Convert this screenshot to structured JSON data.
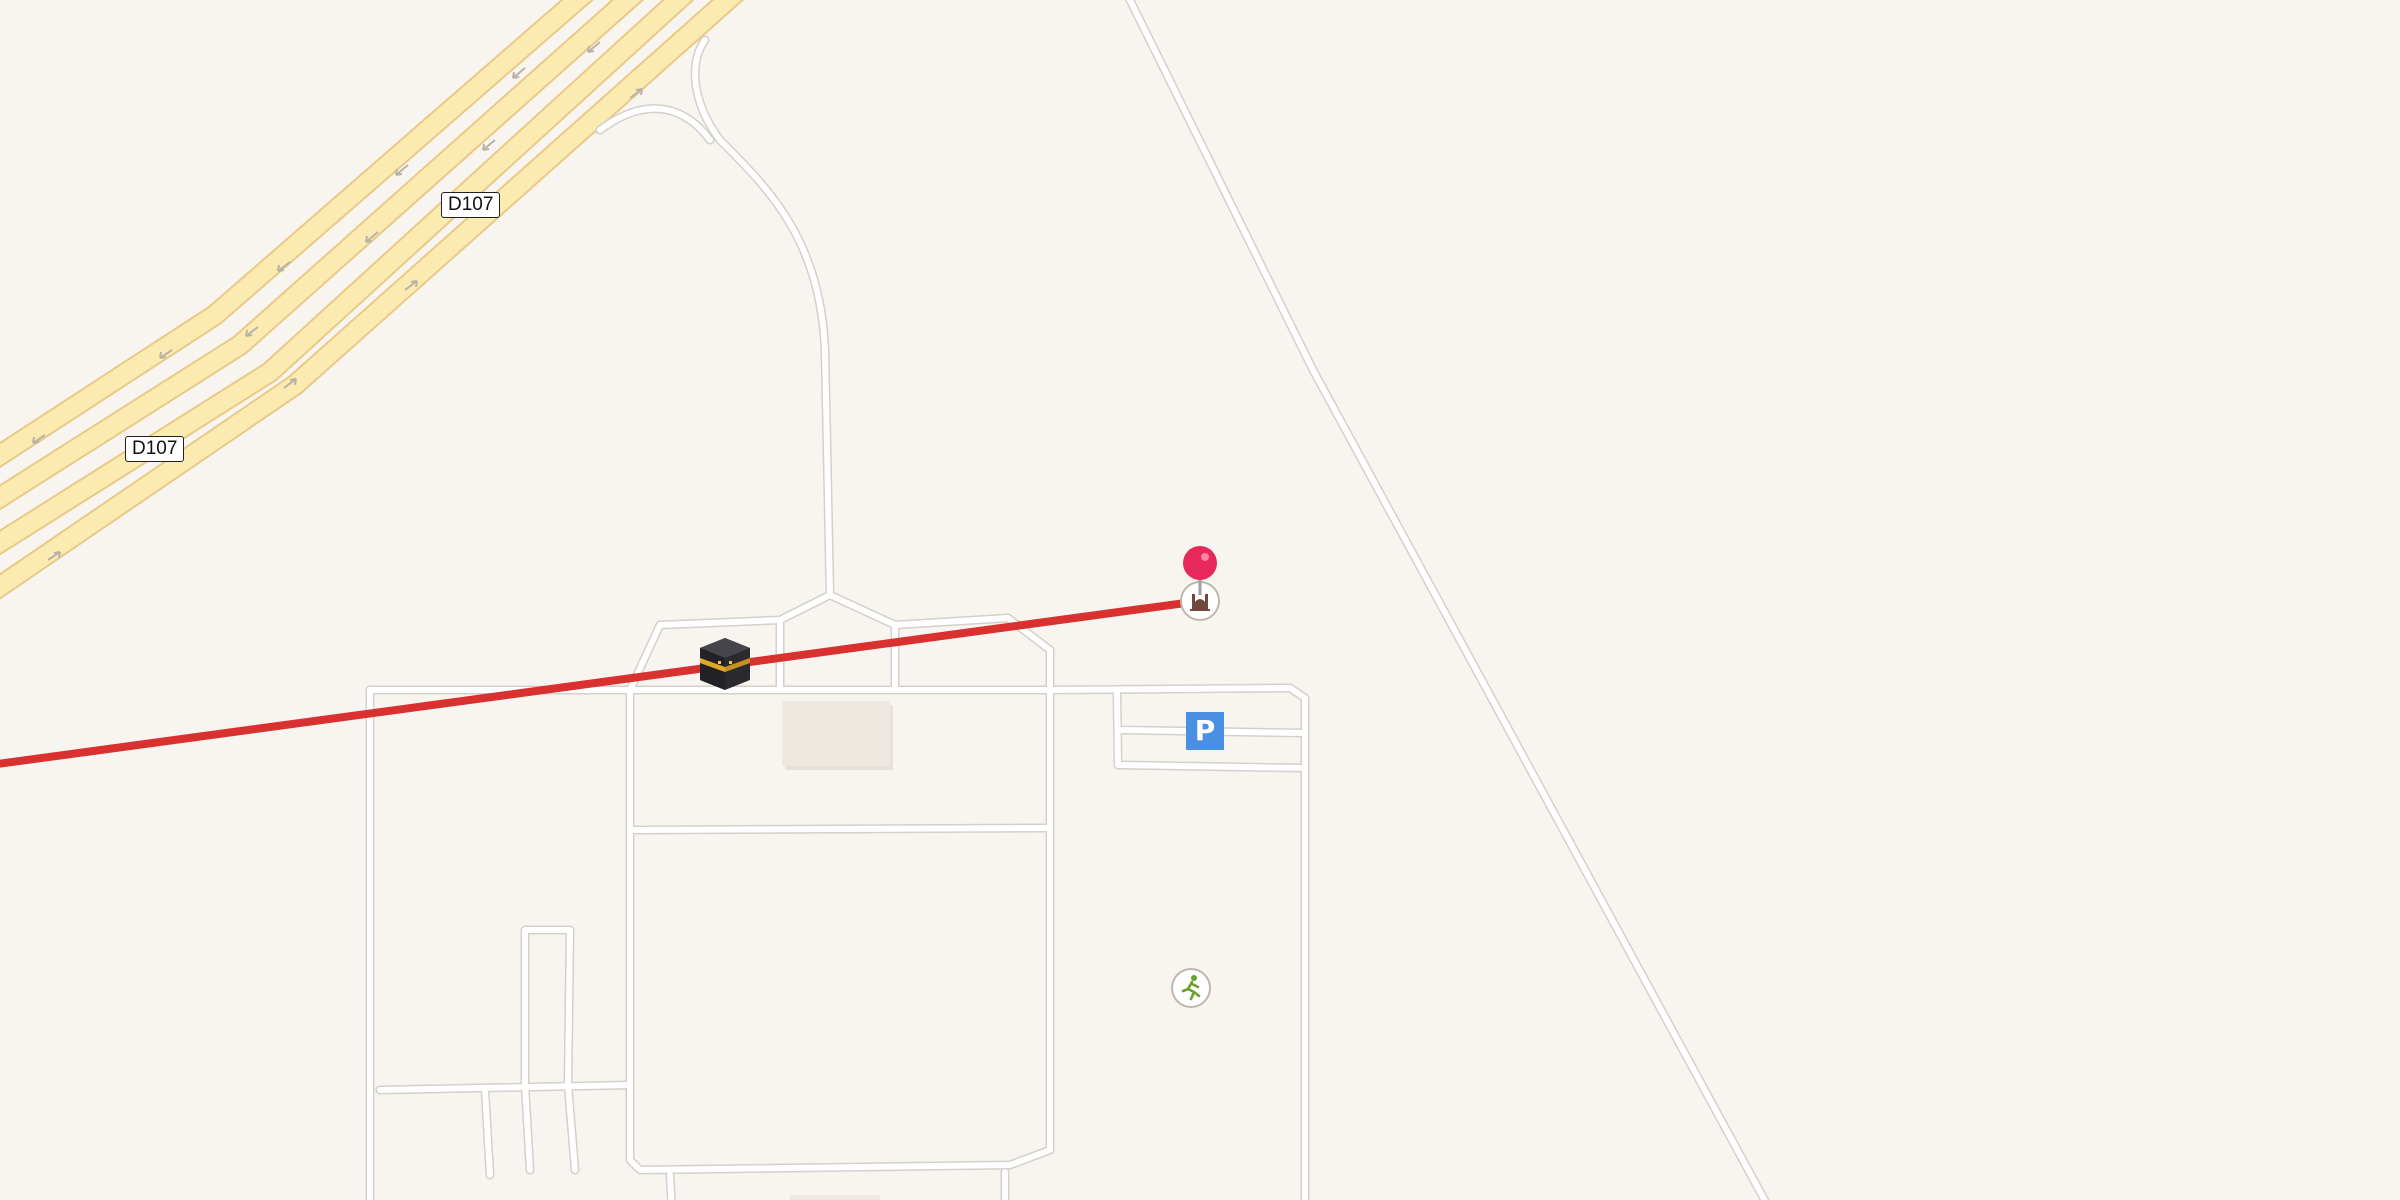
{
  "map": {
    "road_labels": [
      {
        "id": "d107-upper",
        "text": "D107"
      },
      {
        "id": "d107-lower",
        "text": "D107"
      }
    ],
    "pois": [
      {
        "id": "kaaba",
        "icon": "kaaba-icon"
      },
      {
        "id": "mosque",
        "icon": "mosque-icon"
      },
      {
        "id": "parking",
        "icon": "parking-icon",
        "text": "P"
      },
      {
        "id": "sports",
        "icon": "running-person-icon"
      }
    ],
    "marker": {
      "icon": "location-pin-icon",
      "color": "#e8285a"
    },
    "route": {
      "color": "#d93030"
    },
    "colors": {
      "background": "#f8f5f1",
      "highway_fill": "#fcebb0",
      "highway_edge": "#e9c986",
      "minor_road_fill": "#ffffff",
      "minor_road_edge": "#d4d0cb",
      "parking": "#4a90e2",
      "building": "#efe8e1"
    }
  }
}
